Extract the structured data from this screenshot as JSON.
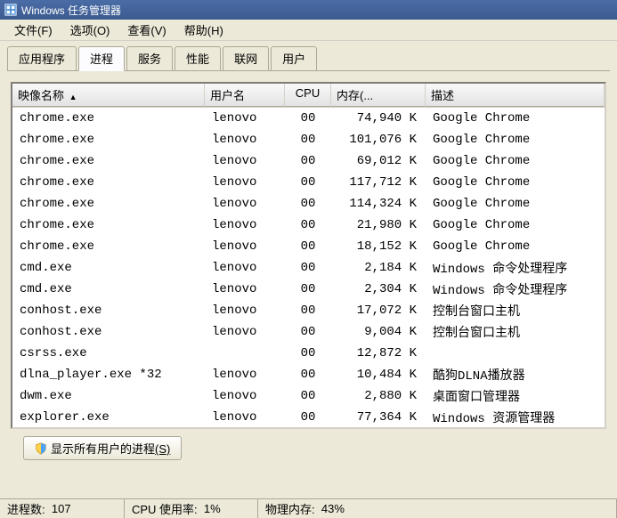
{
  "window": {
    "title": "Windows 任务管理器"
  },
  "menu": {
    "file": "文件(F)",
    "options": "选项(O)",
    "view": "查看(V)",
    "help": "帮助(H)"
  },
  "tabs": {
    "apps": "应用程序",
    "processes": "进程",
    "services": "服务",
    "performance": "性能",
    "networking": "联网",
    "users": "用户"
  },
  "columns": {
    "image_name": "映像名称",
    "user_name": "用户名",
    "cpu": "CPU",
    "memory": "内存(...",
    "description": "描述"
  },
  "processes": [
    {
      "name": "chrome.exe",
      "user": "lenovo",
      "cpu": "00",
      "mem": "74,940 K",
      "desc": "Google Chrome"
    },
    {
      "name": "chrome.exe",
      "user": "lenovo",
      "cpu": "00",
      "mem": "101,076 K",
      "desc": "Google Chrome"
    },
    {
      "name": "chrome.exe",
      "user": "lenovo",
      "cpu": "00",
      "mem": "69,012 K",
      "desc": "Google Chrome"
    },
    {
      "name": "chrome.exe",
      "user": "lenovo",
      "cpu": "00",
      "mem": "117,712 K",
      "desc": "Google Chrome"
    },
    {
      "name": "chrome.exe",
      "user": "lenovo",
      "cpu": "00",
      "mem": "114,324 K",
      "desc": "Google Chrome"
    },
    {
      "name": "chrome.exe",
      "user": "lenovo",
      "cpu": "00",
      "mem": "21,980 K",
      "desc": "Google Chrome"
    },
    {
      "name": "chrome.exe",
      "user": "lenovo",
      "cpu": "00",
      "mem": "18,152 K",
      "desc": "Google Chrome"
    },
    {
      "name": "cmd.exe",
      "user": "lenovo",
      "cpu": "00",
      "mem": "2,184 K",
      "desc": "Windows 命令处理程序"
    },
    {
      "name": "cmd.exe",
      "user": "lenovo",
      "cpu": "00",
      "mem": "2,304 K",
      "desc": "Windows 命令处理程序"
    },
    {
      "name": "conhost.exe",
      "user": "lenovo",
      "cpu": "00",
      "mem": "17,072 K",
      "desc": "控制台窗口主机"
    },
    {
      "name": "conhost.exe",
      "user": "lenovo",
      "cpu": "00",
      "mem": "9,004 K",
      "desc": "控制台窗口主机"
    },
    {
      "name": "csrss.exe",
      "user": "",
      "cpu": "00",
      "mem": "12,872 K",
      "desc": ""
    },
    {
      "name": "dlna_player.exe *32",
      "user": "lenovo",
      "cpu": "00",
      "mem": "10,484 K",
      "desc": "酷狗DLNA播放器"
    },
    {
      "name": "dwm.exe",
      "user": "lenovo",
      "cpu": "00",
      "mem": "2,880 K",
      "desc": "桌面窗口管理器"
    },
    {
      "name": "explorer.exe",
      "user": "lenovo",
      "cpu": "00",
      "mem": "77,364 K",
      "desc": "Windows 资源管理器"
    }
  ],
  "buttons": {
    "show_all_users": "显示所有用户的进程",
    "show_all_users_accel": "(S)"
  },
  "status": {
    "process_count_label": "进程数:",
    "process_count": "107",
    "cpu_usage_label": "CPU 使用率:",
    "cpu_usage": "1%",
    "phys_mem_label": "物理内存:",
    "phys_mem": "43%"
  }
}
